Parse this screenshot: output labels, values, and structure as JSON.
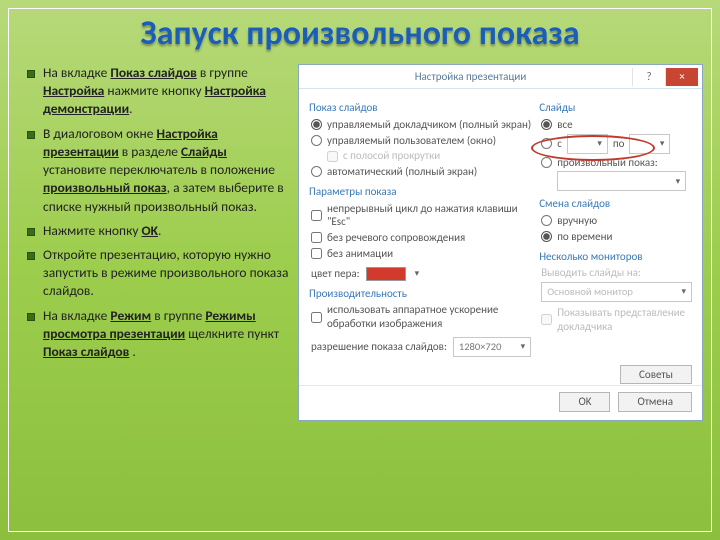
{
  "title": "Запуск произвольного показа",
  "bullets": [
    {
      "pre": "На вкладке ",
      "b1": "Показ слайдов",
      "mid1": " в группе ",
      "b2": "Настройка",
      "mid2": " нажмите кнопку ",
      "b3": "Настройка демонстрации",
      "post": "."
    },
    {
      "pre": "В диалоговом окне ",
      "b1": "Настройка презентации",
      "mid1": " в разделе ",
      "b2": "Слайды",
      "mid2": " установите переключатель в положение ",
      "b3": "произвольный показ",
      "post": ", а затем выберите в списке нужный произвольный показ."
    },
    {
      "pre": "Нажмите кнопку ",
      "b1": "OK",
      "post": "."
    },
    {
      "pre": "Откройте презентацию, которую нужно запустить в режиме произвольного показа слайдов."
    },
    {
      "pre": "На вкладке ",
      "b1": "Режим",
      "mid1": " в группе ",
      "b2": "Режимы просмотра презентации",
      "mid2": " щелкните пункт ",
      "b3": "Показ слайдов",
      "post": " ."
    }
  ],
  "dlg": {
    "title": "Настройка презентации",
    "help": "?",
    "close": "×",
    "left": {
      "g1": "Показ слайдов",
      "r1": "управляемый докладчиком (полный экран)",
      "r2": "управляемый пользователем (окно)",
      "c1": "с полосой прокрутки",
      "r3": "автоматический (полный экран)",
      "g2": "Параметры показа",
      "c2": "непрерывный цикл до нажатия клавиши \"Esc\"",
      "c3": "без речевого сопровождения",
      "c4": "без анимации",
      "penlbl": "цвет пера:",
      "g3": "Производительность",
      "c5": "использовать аппаратное ускорение обработки изображения",
      "reslbl": "разрешение показа слайдов:",
      "resval": "1280×720"
    },
    "right": {
      "g1": "Слайды",
      "r1": "все",
      "r2f": "с",
      "r2t": "по",
      "r3": "произвольный показ:",
      "g2": "Смена слайдов",
      "r4": "вручную",
      "r5": "по времени",
      "g3": "Несколько мониторов",
      "mlbl": "Выводить слайды на:",
      "mval": "Основной монитор",
      "c1": "Показывать представление докладчика",
      "tips": "Советы"
    },
    "ok": "OK",
    "cancel": "Отмена"
  }
}
